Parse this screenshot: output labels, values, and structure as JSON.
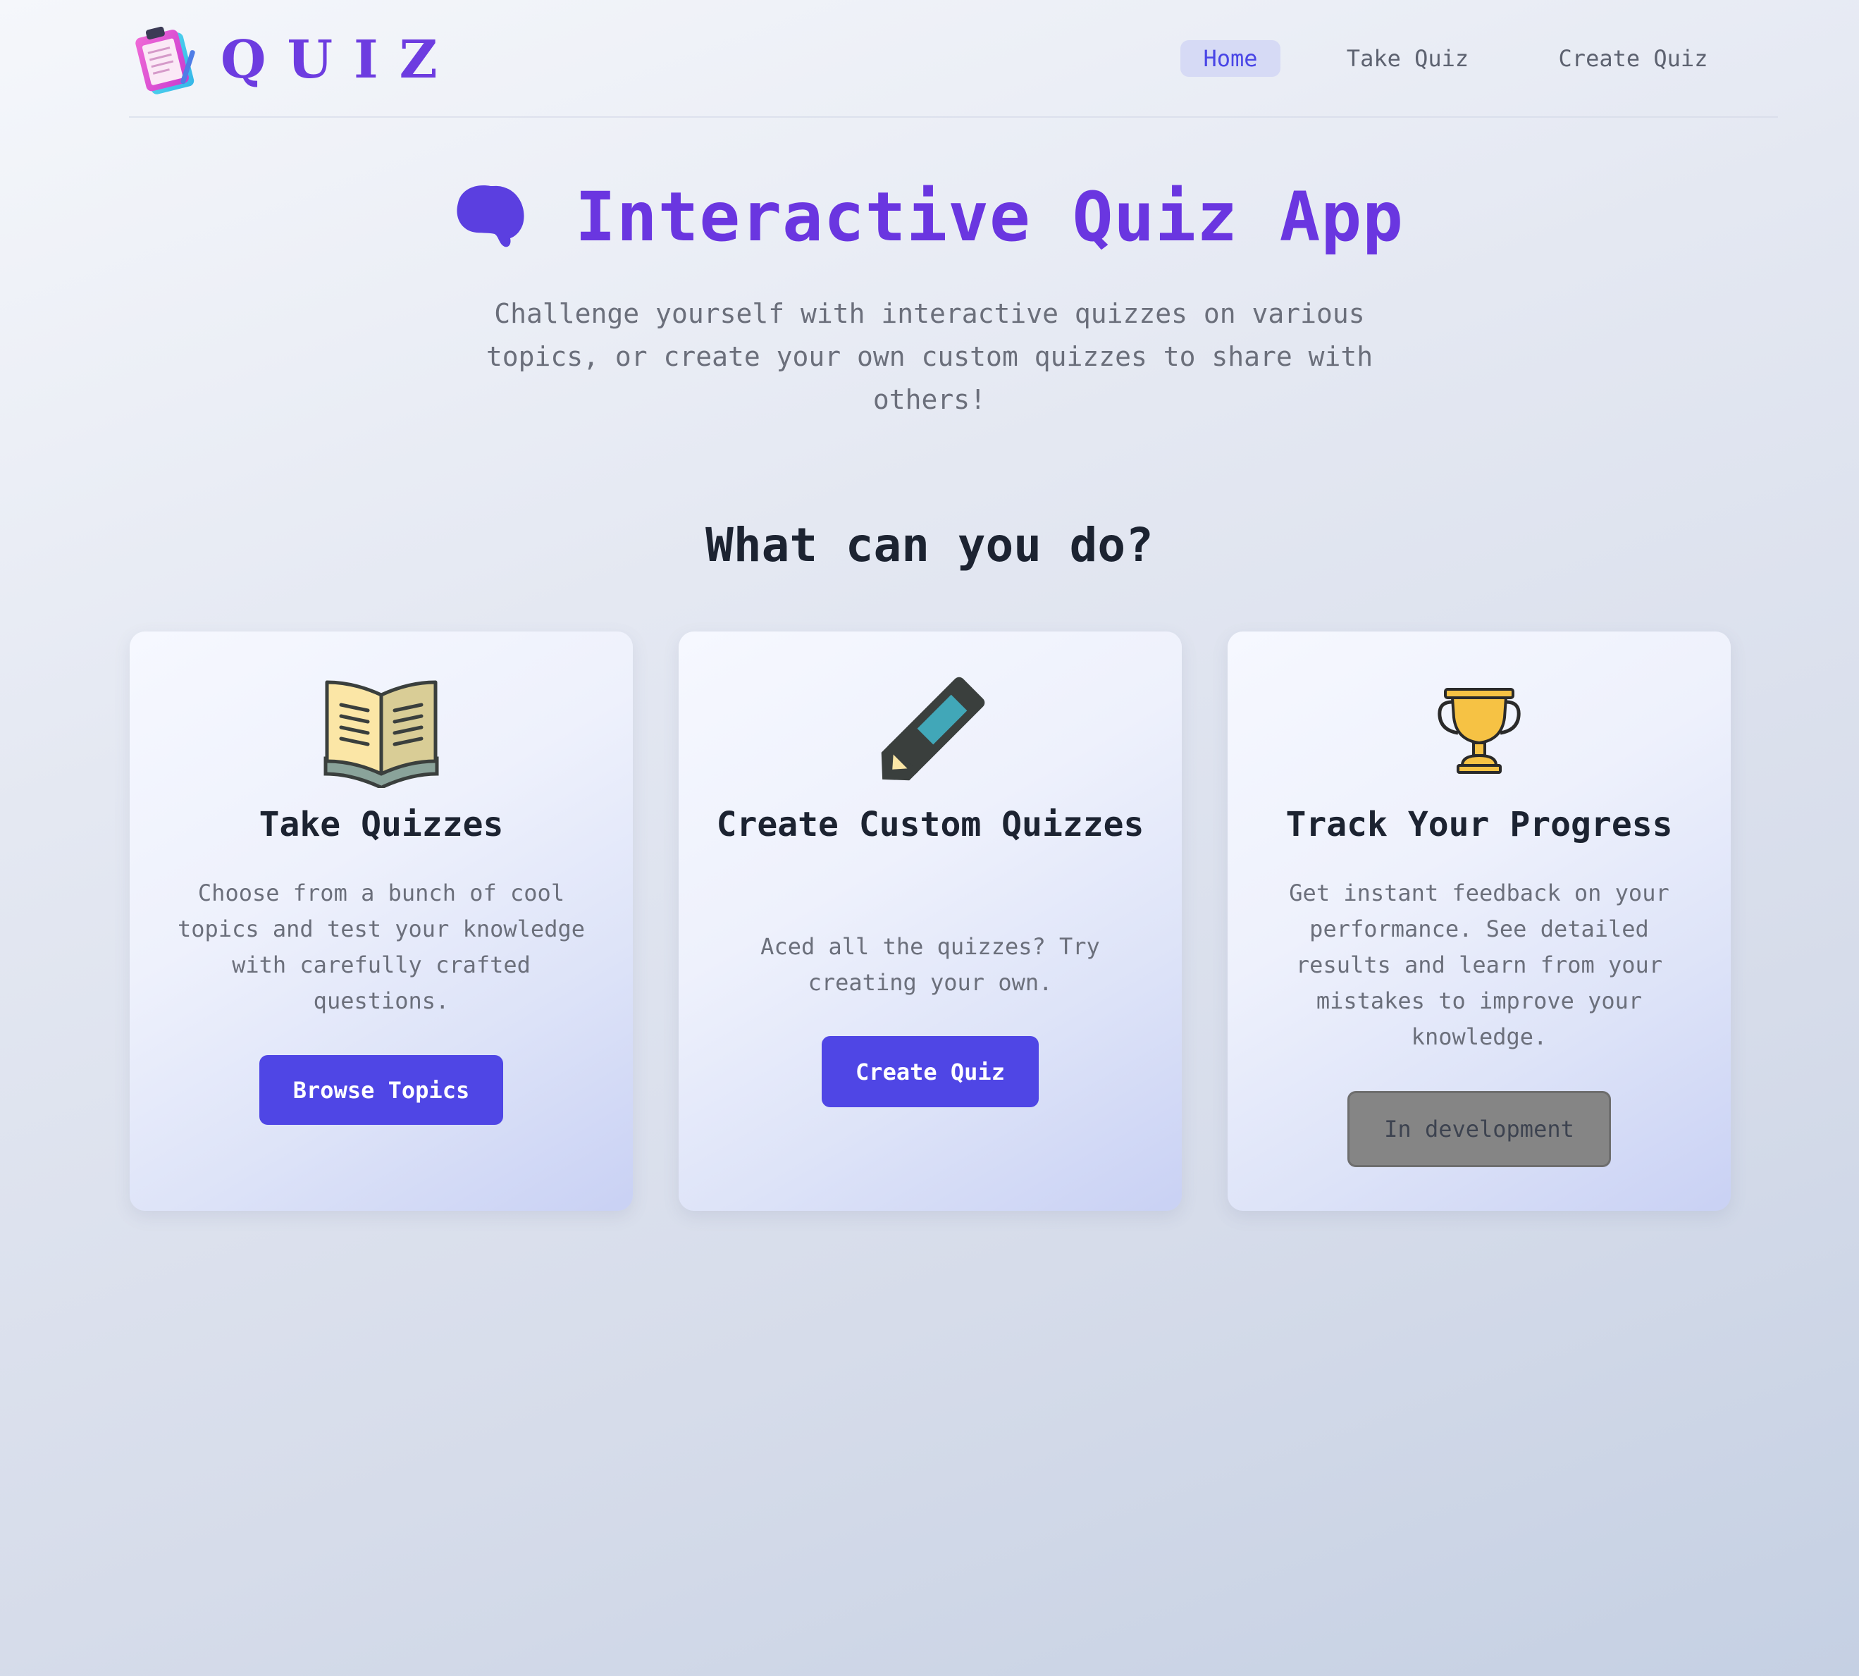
{
  "app": {
    "logo_text": "QUIZ",
    "accent_color": "#6a36e0",
    "button_color": "#4f46e5"
  },
  "nav": {
    "items": [
      {
        "label": "Home",
        "active": true
      },
      {
        "label": "Take Quiz",
        "active": false
      },
      {
        "label": "Create Quiz",
        "active": false
      }
    ]
  },
  "hero": {
    "icon": "brain-icon",
    "title": "Interactive Quiz App",
    "subtitle": "Challenge yourself with interactive quizzes on various topics, or create your own custom quizzes to share with others!"
  },
  "section": {
    "title": "What can you do?"
  },
  "cards": [
    {
      "icon": "open-book-icon",
      "title": "Take Quizzes",
      "description": "Choose from a bunch of cool topics and test your knowledge with carefully crafted questions.",
      "button": "Browse Topics",
      "button_disabled": false
    },
    {
      "icon": "pencil-icon",
      "title": "Create Custom Quizzes",
      "description": "Aced all the quizzes? Try creating your own.",
      "button": "Create Quiz",
      "button_disabled": false
    },
    {
      "icon": "trophy-icon",
      "title": "Track Your Progress",
      "description": "Get instant feedback on your performance. See detailed results and learn from your mistakes to improve your knowledge.",
      "button": "In development",
      "button_disabled": true
    }
  ]
}
